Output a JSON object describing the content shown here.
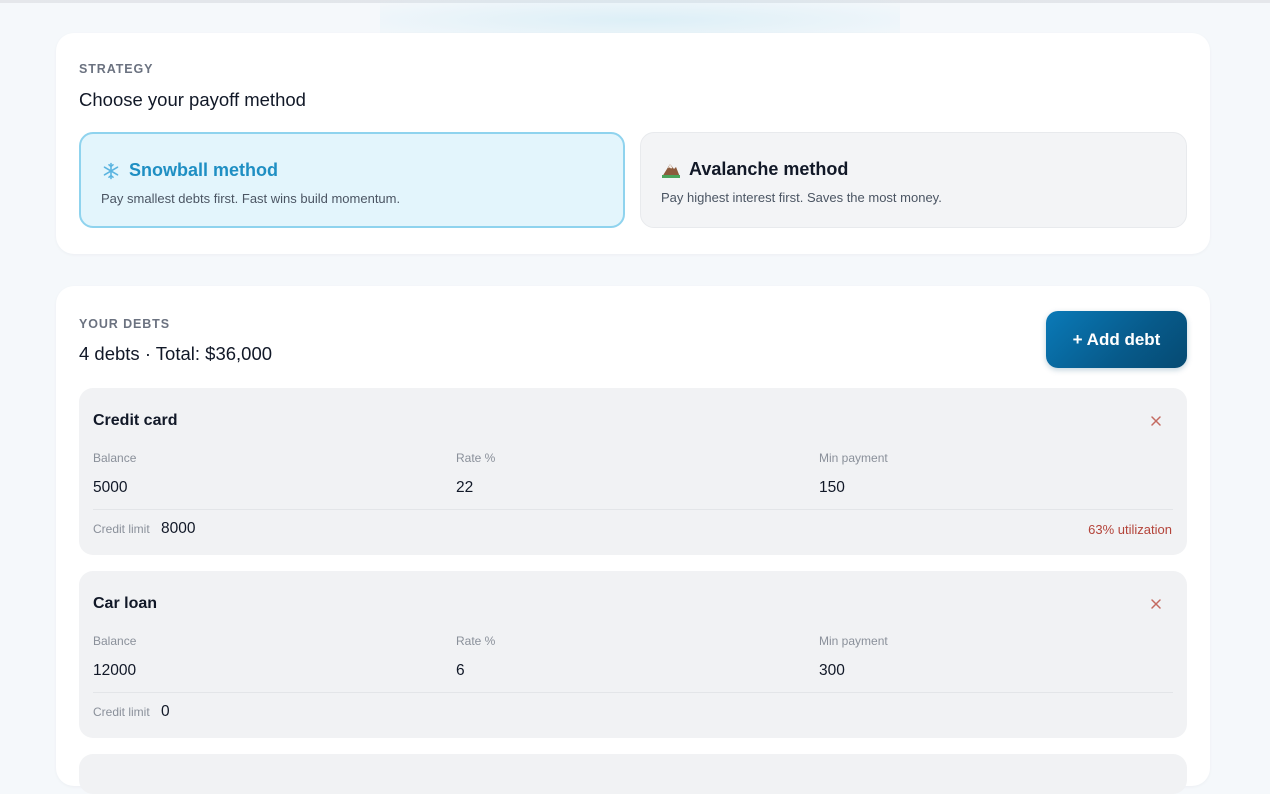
{
  "strategy": {
    "eyebrow": "STRATEGY",
    "heading": "Choose your payoff method",
    "methods": [
      {
        "icon": "snowflake-icon",
        "title": "Snowball method",
        "description": "Pay smallest debts first. Fast wins build momentum.",
        "selected": true
      },
      {
        "icon": "mountain-icon",
        "title": "Avalanche method",
        "description": "Pay highest interest first. Saves the most money.",
        "selected": false
      }
    ]
  },
  "debts": {
    "eyebrow": "YOUR DEBTS",
    "summary": "4 debts · Total: $36,000",
    "add_label": "+ Add debt",
    "labels": {
      "balance": "Balance",
      "rate": "Rate %",
      "min_payment": "Min payment",
      "credit_limit": "Credit limit"
    },
    "items": [
      {
        "name": "Credit card",
        "balance": "5000",
        "rate": "22",
        "min_payment": "150",
        "credit_limit": "8000",
        "utilization": "63% utilization"
      },
      {
        "name": "Car loan",
        "balance": "12000",
        "rate": "6",
        "min_payment": "300",
        "credit_limit": "0"
      }
    ]
  },
  "colors": {
    "accent": "#1f8fc3",
    "selected_bg": "#e3f5fc",
    "button": "#075a8a",
    "danger": "#b4443a"
  }
}
